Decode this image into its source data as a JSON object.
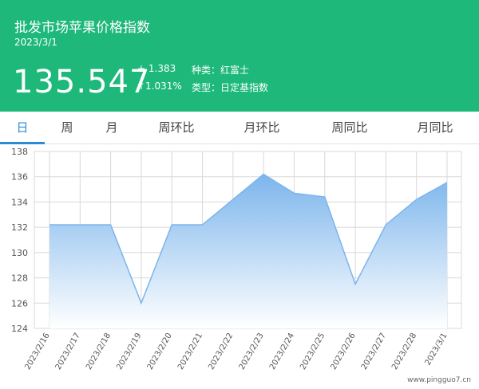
{
  "header": {
    "title": "批发市场苹果价格指数",
    "date": "2023/3/1",
    "price": "135.547",
    "change_abs": "+ 1.383",
    "change_pct": "↑1.031%",
    "variety": "种类：红富士",
    "type": "类型：日定基指数"
  },
  "tabs": [
    {
      "label": "日",
      "active": true
    },
    {
      "label": "周",
      "active": false
    },
    {
      "label": "月",
      "active": false
    },
    {
      "label": "周环比",
      "active": false
    },
    {
      "label": "月环比",
      "active": false
    },
    {
      "label": "周同比",
      "active": false
    },
    {
      "label": "月同比",
      "active": false
    }
  ],
  "chart_data": {
    "type": "area",
    "categories": [
      "2023/2/16",
      "2023/2/17",
      "2023/2/18",
      "2023/2/19",
      "2023/2/20",
      "2023/2/21",
      "2023/2/22",
      "2023/2/23",
      "2023/2/24",
      "2023/2/25",
      "2023/2/26",
      "2023/2/27",
      "2023/2/28",
      "2023/3/1"
    ],
    "values": [
      132.2,
      132.2,
      132.2,
      126.0,
      132.2,
      132.2,
      134.2,
      136.2,
      134.7,
      134.4,
      127.5,
      132.2,
      134.2,
      135.547
    ],
    "yticks": [
      124,
      126,
      128,
      130,
      132,
      134,
      136,
      138
    ],
    "ylim": [
      124,
      138
    ],
    "grid": true,
    "colors": {
      "fill_top": "#7cb5ec",
      "fill_bottom": "#ffffff",
      "line": "#7cb5ec",
      "grid": "#d8d8d8"
    }
  },
  "watermark": "www.pingguo7.cn"
}
